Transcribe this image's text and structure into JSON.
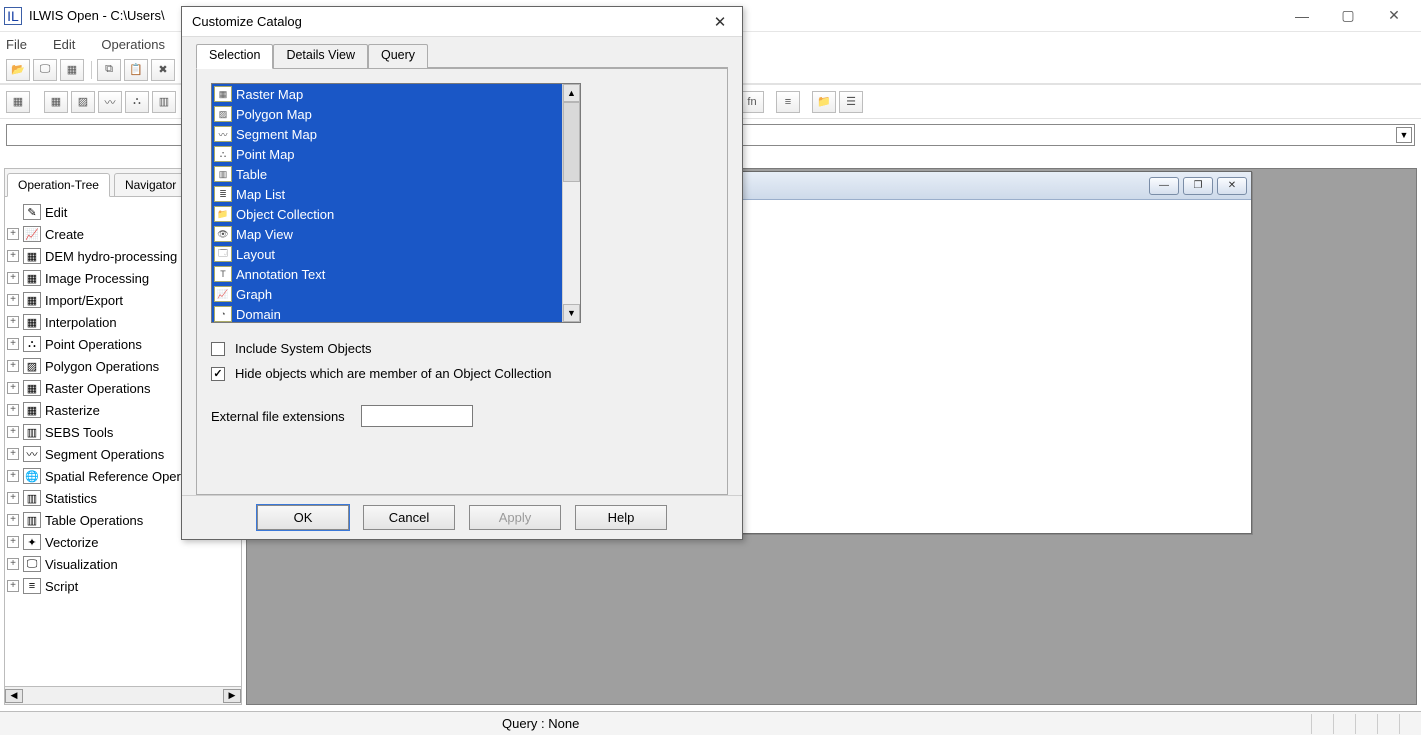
{
  "main_window": {
    "title": "ILWIS Open - C:\\Users\\",
    "menu": [
      "File",
      "Edit",
      "Operations"
    ],
    "win_controls": {
      "min": "—",
      "max": "▢",
      "close": "✕"
    }
  },
  "toolbar_row2_fn_label": "fn",
  "left_panel": {
    "tabs": [
      "Operation-Tree",
      "Navigator"
    ],
    "active_tab": 0,
    "root": "Edit",
    "items": [
      "Create",
      "DEM hydro-processing",
      "Image Processing",
      "Import/Export",
      "Interpolation",
      "Point Operations",
      "Polygon Operations",
      "Raster Operations",
      "Rasterize",
      "SEBS Tools",
      "Segment Operations",
      "Spatial Reference Operations",
      "Statistics",
      "Table Operations",
      "Vectorize",
      "Visualization",
      "Script"
    ]
  },
  "mdi_child": {
    "controls": {
      "min": "—",
      "max": "❐",
      "close": "✕"
    }
  },
  "statusbar": {
    "query": "Query : None"
  },
  "dialog": {
    "title": "Customize Catalog",
    "tabs": [
      "Selection",
      "Details View",
      "Query"
    ],
    "active_tab": 0,
    "list_items": [
      "Raster Map",
      "Polygon Map",
      "Segment Map",
      "Point Map",
      "Table",
      "Map List",
      "Object Collection",
      "Map View",
      "Layout",
      "Annotation Text",
      "Graph",
      "Domain"
    ],
    "checkbox1": {
      "label": "Include System Objects",
      "checked": false
    },
    "checkbox2": {
      "label": "Hide objects which are member of an Object Collection",
      "checked": true
    },
    "ext_label": "External file extensions",
    "ext_value": "",
    "buttons": {
      "ok": "OK",
      "cancel": "Cancel",
      "apply": "Apply",
      "help": "Help"
    }
  }
}
